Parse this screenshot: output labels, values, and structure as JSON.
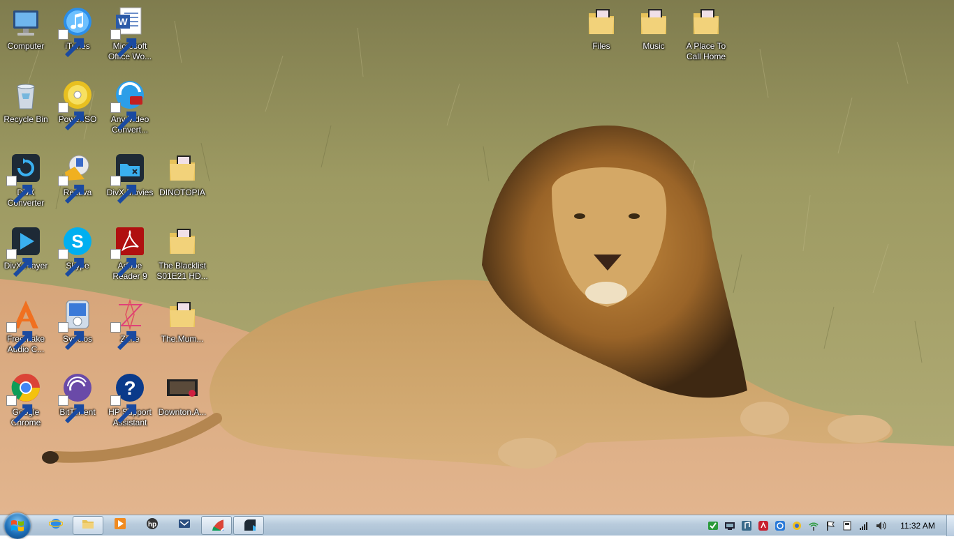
{
  "desktop": {
    "icons": [
      {
        "key": "computer",
        "label": "Computer",
        "icon": "computer-icon",
        "shortcut": false
      },
      {
        "key": "itunes",
        "label": "iTunes",
        "icon": "itunes-icon",
        "shortcut": true
      },
      {
        "key": "word",
        "label": "Microsoft\nOffice Wo...",
        "icon": "word-icon",
        "shortcut": true
      },
      {
        "key": "files",
        "label": "Files",
        "icon": "folder-icon",
        "shortcut": false
      },
      {
        "key": "music",
        "label": "Music",
        "icon": "folder-icon",
        "shortcut": false
      },
      {
        "key": "place",
        "label": "A Place To\nCall Home",
        "icon": "folder-icon",
        "shortcut": false
      },
      {
        "key": "recycle",
        "label": "Recycle Bin",
        "icon": "recycle-bin-icon",
        "shortcut": false
      },
      {
        "key": "poweriso",
        "label": "PowerISO",
        "icon": "poweriso-icon",
        "shortcut": true
      },
      {
        "key": "anyvideo",
        "label": "Any Video\nConvert...",
        "icon": "any-video-converter-icon",
        "shortcut": true
      },
      {
        "key": "divxconv",
        "label": "DivX\nConverter",
        "icon": "divx-converter-icon",
        "shortcut": true
      },
      {
        "key": "recuva",
        "label": "Recuva",
        "icon": "recuva-icon",
        "shortcut": true
      },
      {
        "key": "divxmovies",
        "label": "DivX Movies",
        "icon": "divx-movies-icon",
        "shortcut": true
      },
      {
        "key": "dinotopia",
        "label": "DINOTOPIA",
        "icon": "folder-icon",
        "shortcut": false
      },
      {
        "key": "divxplayer",
        "label": "DivX Player",
        "icon": "divx-player-icon",
        "shortcut": true
      },
      {
        "key": "skype",
        "label": "Skype",
        "icon": "skype-icon",
        "shortcut": true
      },
      {
        "key": "adobe",
        "label": "Adobe\nReader 9",
        "icon": "adobe-reader-icon",
        "shortcut": true
      },
      {
        "key": "blacklist",
        "label": "The Blacklist\nS01E21 HD...",
        "icon": "folder-icon",
        "shortcut": false
      },
      {
        "key": "freemake",
        "label": "Freemake\nAudio C...",
        "icon": "freemake-icon",
        "shortcut": true
      },
      {
        "key": "syncios",
        "label": "Syncios",
        "icon": "syncios-icon",
        "shortcut": true
      },
      {
        "key": "zune",
        "label": "Zune",
        "icon": "zune-icon",
        "shortcut": true
      },
      {
        "key": "mummy",
        "label": "The.Mum...",
        "icon": "folder-icon",
        "shortcut": false
      },
      {
        "key": "chrome",
        "label": "Google\nChrome",
        "icon": "chrome-icon",
        "shortcut": true
      },
      {
        "key": "bittorrent",
        "label": "BitTorrent",
        "icon": "bittorrent-icon",
        "shortcut": true
      },
      {
        "key": "hpsupport",
        "label": "HP Support\nAssistant",
        "icon": "hp-support-icon",
        "shortcut": true
      },
      {
        "key": "downton",
        "label": "Downton.A...",
        "icon": "video-file-icon",
        "shortcut": false
      }
    ]
  },
  "taskbar": {
    "buttons": [
      {
        "key": "ie",
        "icon": "internet-explorer-icon",
        "active": false
      },
      {
        "key": "explorer",
        "icon": "windows-explorer-icon",
        "active": true
      },
      {
        "key": "mediaplayer",
        "icon": "media-player-icon",
        "active": false
      },
      {
        "key": "hp",
        "icon": "hp-icon",
        "active": false
      },
      {
        "key": "mail",
        "icon": "mail-icon",
        "active": false
      },
      {
        "key": "chrome",
        "icon": "chrome-icon",
        "active": true
      },
      {
        "key": "divx",
        "icon": "divx-player-icon",
        "active": true
      }
    ],
    "tray": [
      "green-app-icon",
      "network-device-icon",
      "music-note-icon",
      "red-app-icon",
      "bluetooth-icon",
      "security-icon",
      "wireless-icon",
      "action-center-flag-icon",
      "device-icon",
      "signal-bars-icon",
      "volume-icon"
    ],
    "clock": "11:32 AM"
  },
  "colors": {
    "taskbar": "#b8cbdc",
    "grass": "#9a9a5e",
    "sand": "#d9a77a",
    "lion": "#c99a5a",
    "mane": "#5a3a1c"
  }
}
